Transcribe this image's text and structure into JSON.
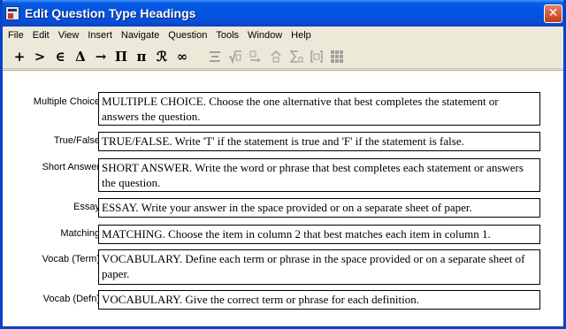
{
  "window": {
    "title": "Edit Question Type Headings",
    "close_glyph": "✕"
  },
  "menubar": {
    "items": [
      "File",
      "Edit",
      "View",
      "Insert",
      "Navigate",
      "Question",
      "Tools",
      "Window",
      "Help"
    ]
  },
  "toolbar": {
    "symbols": [
      "+",
      ">",
      "∈",
      "Δ",
      "→",
      "Π",
      "π",
      "ℛ",
      "∞"
    ],
    "disabled_icons": [
      "align-left-icon",
      "radical-icon",
      "indent-icon",
      "superscript-icon",
      "sum-icon",
      "bracket-icon",
      "matrix-icon"
    ]
  },
  "headings": [
    {
      "label": "Multiple Choice",
      "text": "MULTIPLE CHOICE.  Choose the one alternative that best completes the statement or answers the question."
    },
    {
      "label": "True/False",
      "text": "TRUE/FALSE.  Write 'T' if the statement is true and 'F' if the statement is false."
    },
    {
      "label": "Short Answer",
      "text": "SHORT ANSWER.  Write the word or phrase that best completes each statement or answers the question."
    },
    {
      "label": "Essay",
      "text": "ESSAY.  Write your answer in the space provided or on a separate sheet of paper."
    },
    {
      "label": "Matching",
      "text": "MATCHING.  Choose the item in column 2 that best matches each item in column 1."
    },
    {
      "label": "Vocab (Term)",
      "text": "VOCABULARY.  Define each term or phrase in the space provided or on a separate sheet of paper."
    },
    {
      "label": "Vocab (Defn)",
      "text": "VOCABULARY.  Give the correct term or phrase for each definition."
    }
  ]
}
